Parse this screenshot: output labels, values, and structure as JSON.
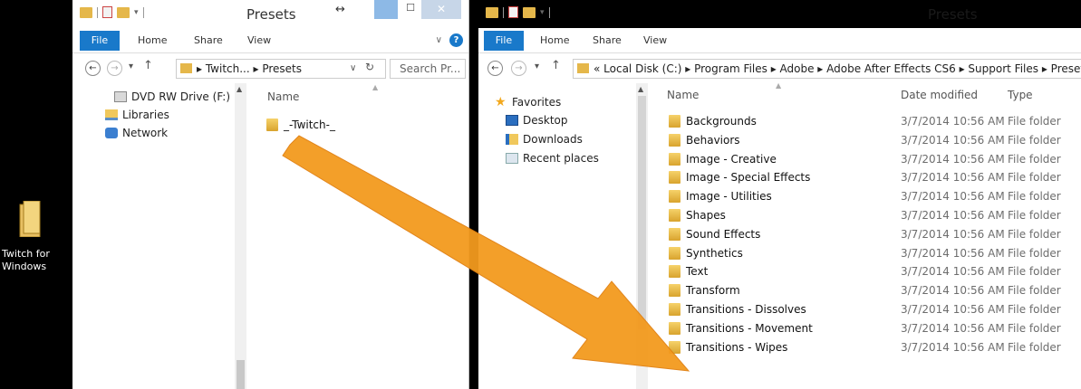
{
  "desktop": {
    "icon_label": "Twitch for Windows"
  },
  "left_window": {
    "title": "Presets",
    "ribbon": {
      "file": "File",
      "home": "Home",
      "share": "Share",
      "view": "View"
    },
    "address": {
      "path": "▸ Twitch... ▸ Presets"
    },
    "search_placeholder": "Search Pr...",
    "nav_items": [
      "DVD RW Drive (F:)",
      "Libraries",
      "Network"
    ],
    "column_name": "Name",
    "files": [
      "_-Twitch-_"
    ]
  },
  "right_window": {
    "title": "Presets",
    "ribbon": {
      "file": "File",
      "home": "Home",
      "share": "Share",
      "view": "View"
    },
    "address": {
      "path": "« Local Disk (C:) ▸ Program Files ▸ Adobe ▸ Adobe After Effects CS6 ▸ Support Files ▸ Presets"
    },
    "nav_items": [
      "Favorites",
      "Desktop",
      "Downloads",
      "Recent places"
    ],
    "columns": {
      "name": "Name",
      "date": "Date modified",
      "type": "Type"
    },
    "files": [
      {
        "name": "Backgrounds",
        "date": "3/7/2014 10:56 AM",
        "type": "File folder"
      },
      {
        "name": "Behaviors",
        "date": "3/7/2014 10:56 AM",
        "type": "File folder"
      },
      {
        "name": "Image - Creative",
        "date": "3/7/2014 10:56 AM",
        "type": "File folder"
      },
      {
        "name": "Image - Special Effects",
        "date": "3/7/2014 10:56 AM",
        "type": "File folder"
      },
      {
        "name": "Image - Utilities",
        "date": "3/7/2014 10:56 AM",
        "type": "File folder"
      },
      {
        "name": "Shapes",
        "date": "3/7/2014 10:56 AM",
        "type": "File folder"
      },
      {
        "name": "Sound Effects",
        "date": "3/7/2014 10:56 AM",
        "type": "File folder"
      },
      {
        "name": "Synthetics",
        "date": "3/7/2014 10:56 AM",
        "type": "File folder"
      },
      {
        "name": "Text",
        "date": "3/7/2014 10:56 AM",
        "type": "File folder"
      },
      {
        "name": "Transform",
        "date": "3/7/2014 10:56 AM",
        "type": "File folder"
      },
      {
        "name": "Transitions - Dissolves",
        "date": "3/7/2014 10:56 AM",
        "type": "File folder"
      },
      {
        "name": "Transitions - Movement",
        "date": "3/7/2014 10:56 AM",
        "type": "File folder"
      },
      {
        "name": "Transitions - Wipes",
        "date": "3/7/2014 10:56 AM",
        "type": "File folder"
      }
    ]
  },
  "colors": {
    "accent": "#1979ca",
    "arrow": "#f39a1e",
    "folder": "#e5b74a"
  }
}
